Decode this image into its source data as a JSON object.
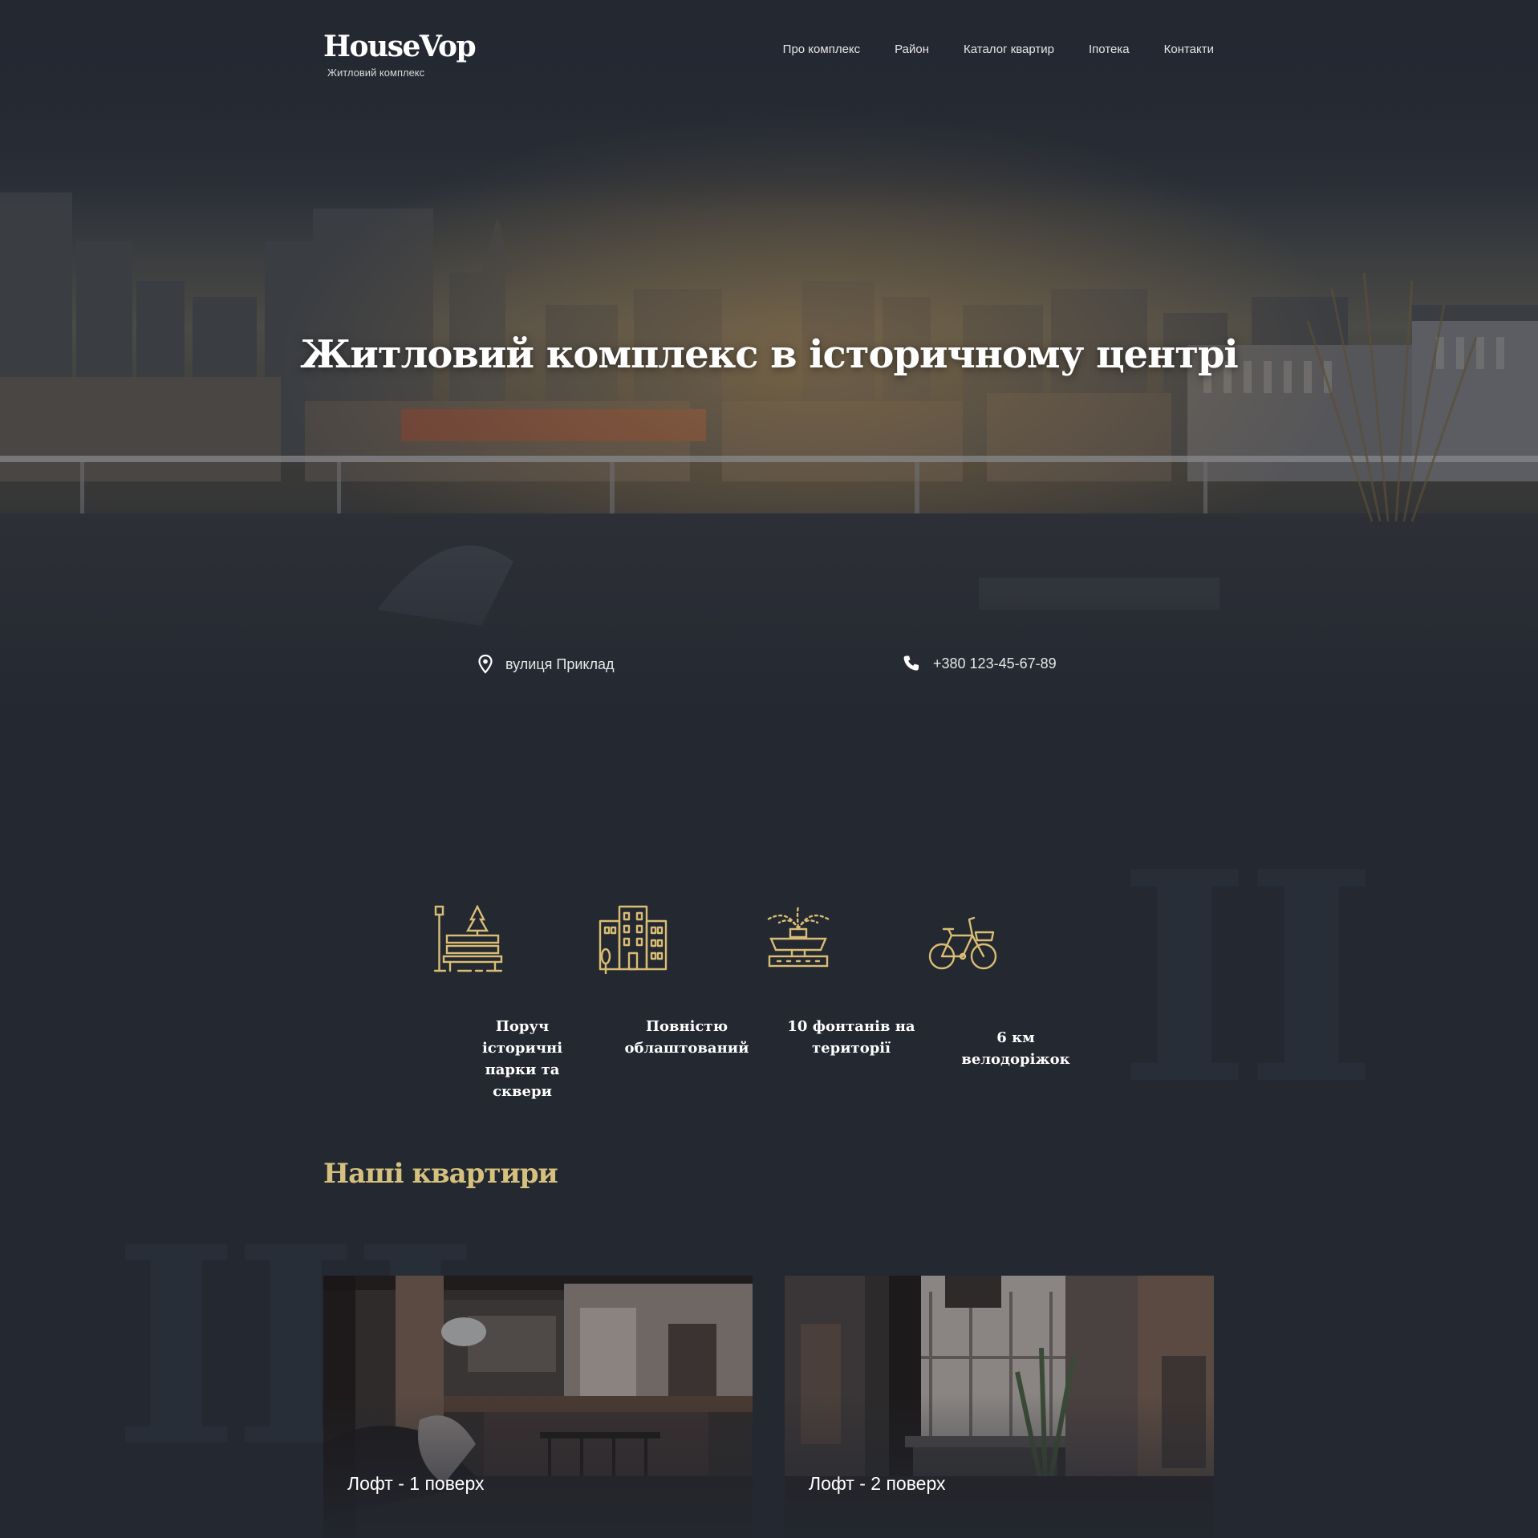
{
  "logo": {
    "name": "HouseVop",
    "subtitle": "Житловий комплекс"
  },
  "nav": {
    "items": [
      {
        "label": "Про комплекс"
      },
      {
        "label": "Район"
      },
      {
        "label": "Каталог квартир"
      },
      {
        "label": "Іпотека"
      },
      {
        "label": "Контакти"
      }
    ]
  },
  "hero": {
    "title": "Житловий комплекс в історичному центрі"
  },
  "contacts": {
    "address": "вулиця Приклад",
    "phone": "+380 123-45-67-89"
  },
  "features": {
    "items": [
      {
        "icon": "park-bench-icon",
        "text": "Поруч історичні парки та сквери"
      },
      {
        "icon": "buildings-icon",
        "text": "Повністю облаштований"
      },
      {
        "icon": "fountain-icon",
        "text": "10 фонтанів на території"
      },
      {
        "icon": "bicycle-icon",
        "text": "6 км велодоріжок"
      }
    ]
  },
  "apartments": {
    "title": "Наші квартири",
    "cards": [
      {
        "label": "Лофт - 1 поверх"
      },
      {
        "label": "Лофт - 2 поверх"
      }
    ]
  },
  "decor": {
    "numeral_2": "II",
    "numeral_3": "III"
  },
  "colors": {
    "background": "#232831",
    "accent_gold": "#d5c17d",
    "icon_gold": "#d9bd74",
    "text": "#ffffff"
  }
}
